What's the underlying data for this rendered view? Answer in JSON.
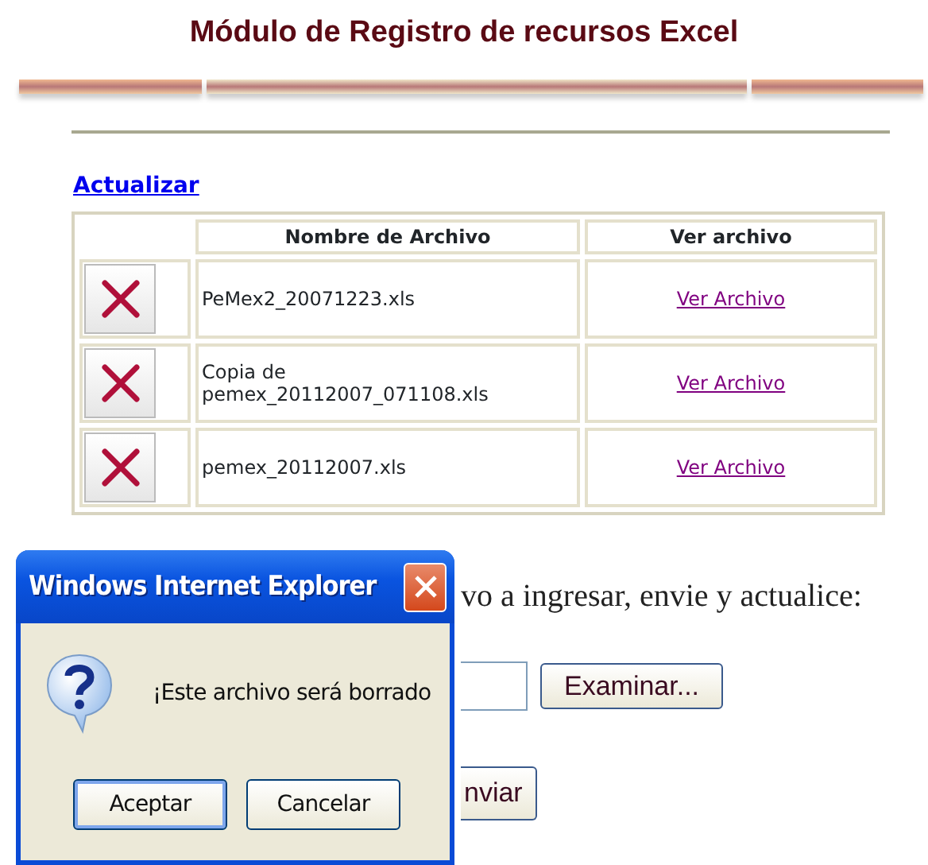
{
  "page_title": "Módulo de Registro de recursos Excel",
  "refresh_link": "Actualizar",
  "table": {
    "columns": [
      "Nombre de Archivo",
      "Ver archivo"
    ],
    "rows": [
      {
        "file_name": "PeMex2_20071223.xls",
        "view_link": "Ver Archivo"
      },
      {
        "file_name": "Copia de pemex_20112007_071108.xls",
        "view_link": "Ver Archivo"
      },
      {
        "file_name": "pemex_20112007.xls",
        "view_link": "Ver Archivo"
      }
    ]
  },
  "upload": {
    "instruction": "vo a ingresar, envie y actualice:",
    "browse_button": "Examinar...",
    "send_button": "nviar"
  },
  "dialog": {
    "title": "Windows Internet Explorer",
    "message": "¡Este archivo será borrado",
    "buttons": [
      "Aceptar",
      "Cancelar"
    ]
  }
}
